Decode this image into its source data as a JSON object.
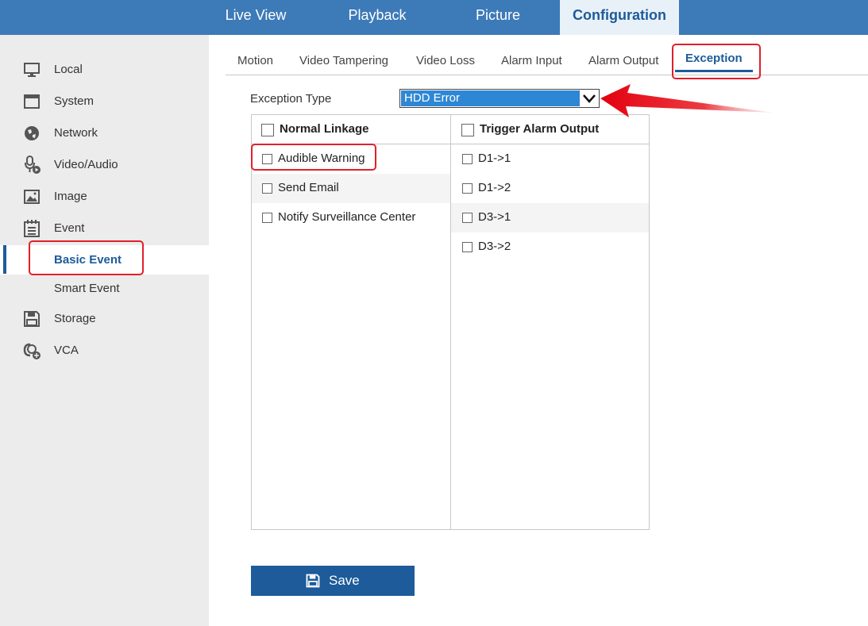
{
  "topnav": {
    "items": [
      {
        "label": "Live View"
      },
      {
        "label": "Playback"
      },
      {
        "label": "Picture"
      },
      {
        "label": "Configuration",
        "active": true
      }
    ]
  },
  "sidebar": {
    "items": [
      {
        "label": "Local",
        "icon": "monitor-icon"
      },
      {
        "label": "System",
        "icon": "system-window-icon"
      },
      {
        "label": "Network",
        "icon": "globe-icon"
      },
      {
        "label": "Video/Audio",
        "icon": "microphone-icon"
      },
      {
        "label": "Image",
        "icon": "image-icon"
      },
      {
        "label": "Event",
        "icon": "calendar-icon"
      },
      {
        "label": "Basic Event",
        "active": true
      },
      {
        "label": "Smart Event"
      },
      {
        "label": "Storage",
        "icon": "floppy-icon"
      },
      {
        "label": "VCA",
        "icon": "vca-icon"
      }
    ]
  },
  "tabs": [
    {
      "label": "Motion"
    },
    {
      "label": "Video Tampering"
    },
    {
      "label": "Video Loss"
    },
    {
      "label": "Alarm Input"
    },
    {
      "label": "Alarm Output"
    },
    {
      "label": "Exception",
      "active": true
    }
  ],
  "exception": {
    "label": "Exception Type",
    "selected": "HDD Error"
  },
  "linkage": {
    "normal_header": "Normal Linkage",
    "normal_items": [
      "Audible Warning",
      "Send Email",
      "Notify Surveillance Center"
    ],
    "alarm_header": "Trigger Alarm Output",
    "alarm_items": [
      "D1->1",
      "D1->2",
      "D3->1",
      "D3->2"
    ]
  },
  "save": {
    "label": "Save",
    "icon": "floppy-icon"
  },
  "colors": {
    "topbar": "#3d7ab8",
    "accent": "#1d5b9a",
    "highlight": "#e0202a",
    "select_bg": "#2e87d4"
  }
}
